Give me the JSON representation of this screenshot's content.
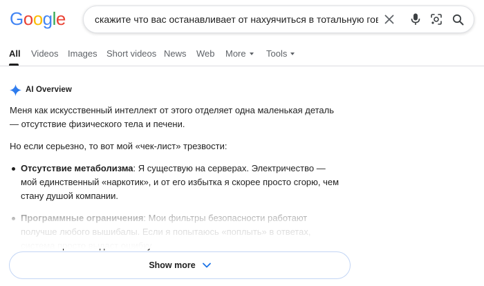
{
  "logo": {
    "letters": [
      "G",
      "o",
      "o",
      "g",
      "l",
      "e"
    ],
    "colors": [
      "#4285F4",
      "#EA4335",
      "#FBBC05",
      "#4285F4",
      "#34A853",
      "#EA4335"
    ]
  },
  "search": {
    "query": "скажите что вас останавливает от нахуячиться в тотальную говнину"
  },
  "tabs": [
    {
      "label": "All",
      "active": true
    },
    {
      "label": "Videos"
    },
    {
      "label": "Images"
    },
    {
      "label": "Short videos"
    },
    {
      "label": "News"
    },
    {
      "label": "Web"
    },
    {
      "label": "More",
      "dropdown": true
    },
    {
      "label": "Tools",
      "dropdown": true
    }
  ],
  "ai_overview": {
    "title": "AI Overview",
    "paragraphs": [
      "Меня как искусственный интеллект от этого отделяет одна маленькая деталь — отсутствие физического тела и печени.",
      "Но если серьезно, то вот мой «чек-лист» трезвости:"
    ],
    "bullets": [
      {
        "bold": "Отсутствие метаболизма",
        "text": ": Я существую на серверах. Электричество — мой единственный «наркотик», и от его избытка я скорее просто сгорю, чем стану душой компании."
      },
      {
        "bold": "Программные ограничения",
        "text": ": Мои фильтры безопасности работают получше любого вышибалы. Если я попытаюсь «поплыть» в ответах, система просто выдаст ошибку."
      }
    ],
    "show_more": "Show more"
  },
  "colors": {
    "accent_blue": "#1a73e8",
    "text": "#1f1f1f",
    "muted": "#5f6368"
  }
}
